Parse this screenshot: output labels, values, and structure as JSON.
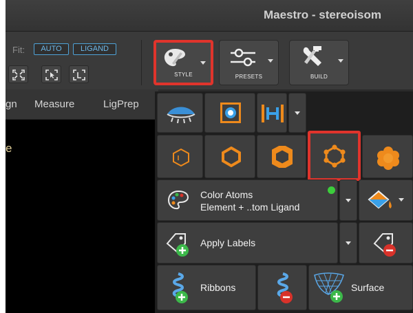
{
  "window": {
    "title": "Maestro - stereoisom"
  },
  "toolbar": {
    "fit_label": "Fit:",
    "fit_auto": "AUTO",
    "fit_ligand": "LIGAND",
    "style_label": "STYLE",
    "presets_label": "PRESETS",
    "build_label": "BUILD"
  },
  "menu": {
    "items": [
      "gn",
      "Measure",
      "LigPrep"
    ]
  },
  "workspace": {
    "text": "e"
  },
  "style_panel": {
    "color_atoms_title": "Color Atoms",
    "color_atoms_scheme": "Element + ..tom Ligand",
    "apply_labels": "Apply Labels",
    "ribbons": "Ribbons",
    "surface": "Surface"
  },
  "colors": {
    "highlight": "#e0342c",
    "accent_blue": "#4fa3d8",
    "representation_orange": "#ee8a1c",
    "add_green": "#3cb84a",
    "remove_red": "#d8322a"
  }
}
